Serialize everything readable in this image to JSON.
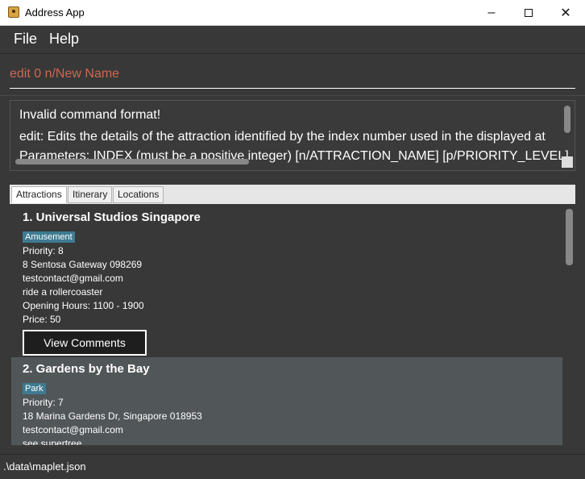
{
  "window": {
    "title": "Address App",
    "controls": {
      "minimize": "–",
      "close": "✕"
    }
  },
  "menu": {
    "items": [
      "File",
      "Help"
    ]
  },
  "command": {
    "value": "edit 0 n/New Name"
  },
  "result": {
    "lines": [
      "Invalid command format!",
      "edit: Edits the details of the attraction identified by the index number used in the displayed at",
      "Parameters: INDEX (must be a positive integer) [n/ATTRACTION_NAME] [p/PRIORITY_LEVEL]"
    ]
  },
  "tabs": [
    "Attractions",
    "Itinerary",
    "Locations"
  ],
  "active_tab": "Attractions",
  "attractions": [
    {
      "title": "1. Universal Studios Singapore",
      "tag": "Amusement",
      "priority": "Priority: 8",
      "address": "8 Sentosa Gateway 098269",
      "email": "testcontact@gmail.com",
      "description": "ride a rollercoaster",
      "hours": "Opening Hours: 1100 - 1900",
      "price": "Price: 50",
      "button": "View Comments"
    },
    {
      "title": "2.  Gardens by the Bay",
      "tag": "Park",
      "priority": "Priority: 7",
      "address": "18 Marina Gardens Dr, Singapore 018953",
      "email": "testcontact@gmail.com",
      "description": "see supertree"
    }
  ],
  "status": {
    "path": ".\\data\\maplet.json"
  },
  "colors": {
    "background": "#383838",
    "command_text": "#d06651",
    "tag": "#3e7b91",
    "selected_card": "#515658"
  },
  "icons": [
    "app-icon",
    "minimize-icon",
    "maximize-icon",
    "close-icon"
  ]
}
